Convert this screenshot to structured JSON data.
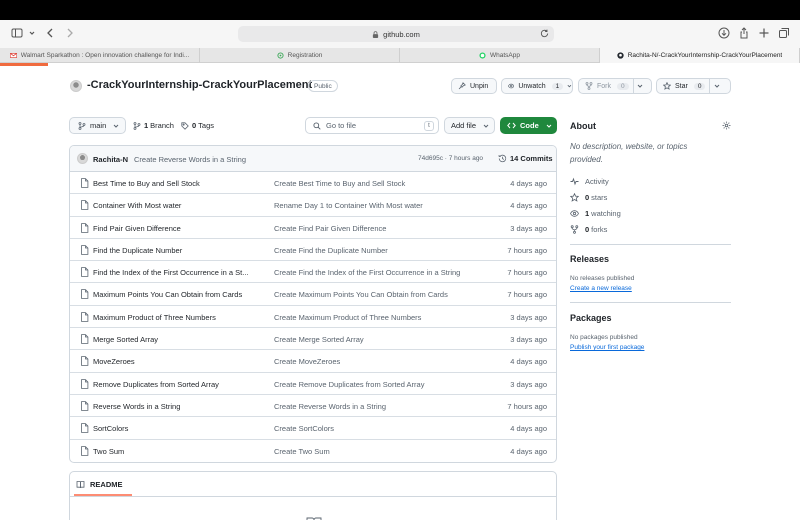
{
  "browser": {
    "url": "github.com",
    "tabs": [
      {
        "title": "Walmart Sparkathon : Open innovation challenge for Indi...",
        "icon": "gmail-icon"
      },
      {
        "title": "Registration",
        "icon": "registration-icon"
      },
      {
        "title": "WhatsApp",
        "icon": "whatsapp-icon"
      },
      {
        "title": "Rachita-N/-CrackYourInternship-CrackYourPlacement",
        "icon": "github-icon"
      }
    ]
  },
  "repo": {
    "name": "-CrackYourInternship-CrackYourPlacement",
    "visibility": "Public",
    "unpin_label": "Unpin",
    "unwatch_label": "Unwatch",
    "watch_count": "1",
    "fork_label": "Fork",
    "fork_count": "0",
    "star_label": "Star",
    "star_count": "0"
  },
  "nav": {
    "branch": "main",
    "branch_count": "1",
    "branch_label": "Branch",
    "tag_count": "0",
    "tag_label": "Tags",
    "goto_placeholder": "Go to file",
    "goto_key": "t",
    "add_file_label": "Add file",
    "code_label": "Code"
  },
  "latest_commit": {
    "author": "Rachita-N",
    "message": "Create Reverse Words in a String",
    "sha_time": "74d695c · 7 hours ago",
    "commits_label": "14 Commits"
  },
  "files": [
    {
      "name": "Best Time to Buy and Sell Stock",
      "message": "Create Best Time to Buy and Sell Stock",
      "age": "4 days ago"
    },
    {
      "name": "Container With Most water",
      "message": "Rename Day 1 to Container With Most water",
      "age": "4 days ago"
    },
    {
      "name": "Find Pair Given Difference",
      "message": "Create Find Pair Given Difference",
      "age": "3 days ago"
    },
    {
      "name": "Find the Duplicate Number",
      "message": "Create Find the Duplicate Number",
      "age": "7 hours ago"
    },
    {
      "name": "Find the Index of the First Occurrence in a St...",
      "message": "Create Find the Index of the First Occurrence in a String",
      "age": "7 hours ago"
    },
    {
      "name": "Maximum Points You Can Obtain from Cards",
      "message": "Create Maximum Points You Can Obtain from Cards",
      "age": "7 hours ago"
    },
    {
      "name": "Maximum Product of Three Numbers",
      "message": "Create Maximum Product of Three Numbers",
      "age": "3 days ago"
    },
    {
      "name": "Merge Sorted Array",
      "message": "Create Merge Sorted Array",
      "age": "3 days ago"
    },
    {
      "name": "MoveZeroes",
      "message": "Create MoveZeroes",
      "age": "4 days ago"
    },
    {
      "name": "Remove Duplicates from Sorted Array",
      "message": "Create Remove Duplicates from Sorted Array",
      "age": "3 days ago"
    },
    {
      "name": "Reverse Words in a String",
      "message": "Create Reverse Words in a String",
      "age": "7 hours ago"
    },
    {
      "name": "SortColors",
      "message": "Create SortColors",
      "age": "4 days ago"
    },
    {
      "name": "Two Sum",
      "message": "Create Two Sum",
      "age": "4 days ago"
    }
  ],
  "readme": {
    "label": "README"
  },
  "sidebar": {
    "about_title": "About",
    "about_desc": "No description, website, or topics provided.",
    "activity": "Activity",
    "stars_count": "0",
    "stars_label": "stars",
    "watching_count": "1",
    "watching_label": "watching",
    "forks_count": "0",
    "forks_label": "forks",
    "releases_title": "Releases",
    "releases_none": "No releases published",
    "releases_link": "Create a new release",
    "packages_title": "Packages",
    "packages_none": "No packages published",
    "packages_link": "Publish your first package"
  },
  "colors": {
    "code_button": "#1f883d",
    "link": "#0969da",
    "progress": "#f06b3f"
  }
}
